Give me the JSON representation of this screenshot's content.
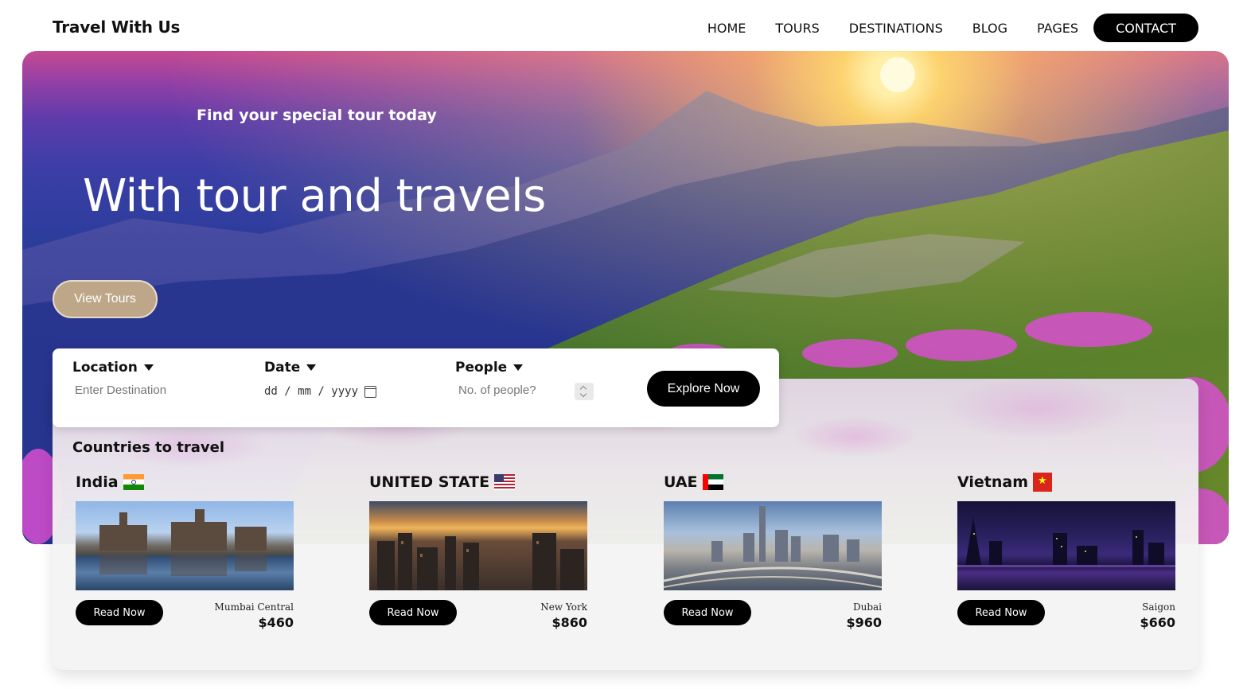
{
  "brand": "Travel With Us",
  "nav": {
    "items": [
      "HOME",
      "TOURS",
      "DESTINATIONS",
      "BLOG",
      "PAGES"
    ],
    "contact": "CONTACT"
  },
  "hero": {
    "subtitle": "Find your special tour today",
    "title": "With tour and travels",
    "cta": "View Tours"
  },
  "search": {
    "location_label": "Location",
    "location_placeholder": "Enter Destination",
    "date_label": "Date",
    "date_placeholder": "dd / mm / yyyy",
    "people_label": "People",
    "people_placeholder": "No. of people?",
    "button": "Explore Now"
  },
  "countries": {
    "title": "Countries to travel",
    "cards": [
      {
        "name": "India",
        "flag": "india-flag",
        "button": "Read Now",
        "place": "Mumbai Central",
        "price": "$460"
      },
      {
        "name": "UNITED STATE",
        "flag": "usa-flag",
        "button": "Read Now",
        "place": "New York",
        "price": "$860"
      },
      {
        "name": "UAE",
        "flag": "uae-flag",
        "button": "Read Now",
        "place": "Dubai",
        "price": "$960"
      },
      {
        "name": "Vietnam",
        "flag": "vietnam-flag",
        "button": "Read Now",
        "place": "Saigon",
        "price": "$660"
      }
    ]
  },
  "colors": {
    "accent": "#000000",
    "view_tours_bg": "#bda788",
    "panel_bg": "#f4f4f4"
  }
}
